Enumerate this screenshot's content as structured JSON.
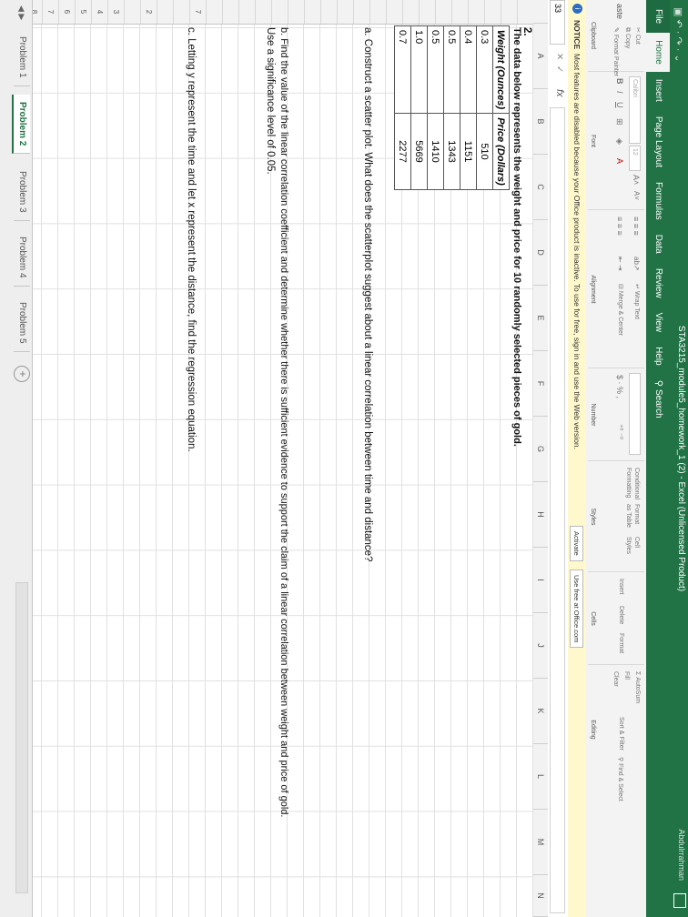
{
  "window": {
    "title": "STA3215_module5_homework_1 (2) - Excel (Unlicensed Product)",
    "user": "Abdulrrahman",
    "qat": "▣ ↶ · ↷ · ⌄"
  },
  "tabs": [
    "File",
    "Home",
    "Insert",
    "Page Layout",
    "Formulas",
    "Data",
    "Review",
    "View",
    "Help",
    "Search"
  ],
  "ribbon": {
    "clipboard": {
      "cut": "Cut",
      "copy": "Copy",
      "format_painter": "Format Painter",
      "paste": "aste",
      "label": "Clipboard"
    },
    "font": {
      "name": "Calibri",
      "size": "12",
      "bold": "B",
      "italic": "I",
      "underline": "U",
      "label": "Font"
    },
    "alignment": {
      "wrap": "Wrap Text",
      "merge": "Merge & Center",
      "label": "Alignment"
    },
    "number": {
      "currency": "$ · % ,",
      "label": "Number"
    },
    "styles": {
      "conditional": "Conditional Formatting",
      "format_as_table": "Format as Table",
      "cell_styles": "Cell Styles",
      "label": "Styles"
    },
    "cells": {
      "insert": "Insert",
      "delete": "Delete",
      "format": "Format",
      "label": "Cells"
    },
    "editing": {
      "autosum": "AutoSum",
      "fill": "Fill",
      "clear": "Clear",
      "sort": "Sort & Filter",
      "find": "Find & Select",
      "label": "Editing"
    }
  },
  "notice": {
    "label": "NOTICE",
    "text": "Most features are disabled because your Office product is inactive. To use for free, sign in and use the Web version.",
    "activate": "Activate",
    "use_free": "Use free at Office.com"
  },
  "formula_bar": {
    "name_box": "33",
    "fx": "fx"
  },
  "columns": [
    "A",
    "B",
    "C",
    "D",
    "E",
    "F",
    "G",
    "H",
    "I",
    "J",
    "K",
    "L",
    "M",
    "N"
  ],
  "rows": [
    "",
    "",
    "",
    "",
    "",
    "",
    "",
    "",
    "",
    "",
    "",
    "",
    "",
    "",
    "",
    "",
    "",
    "",
    "",
    "",
    "7",
    "",
    "",
    "2",
    "",
    "3",
    "4",
    "5",
    "6",
    "7",
    "8"
  ],
  "sheet": {
    "problem_number": "2.",
    "intro": "The data below represents the weight and price for 10 randomly selected pieces of gold.",
    "table_headers": [
      "Weight (Ounces)",
      "Price (Dollars)"
    ],
    "table_rows": [
      [
        "0.3",
        "510"
      ],
      [
        "0.4",
        "1151"
      ],
      [
        "0.5",
        "1343"
      ],
      [
        "0.5",
        "1410"
      ],
      [
        "1.0",
        "5669"
      ],
      [
        "0.7",
        "2277"
      ]
    ],
    "part_a": "a. Construct a scatter plot. What does the scatterplot suggest about a linear correlation between time and distance?",
    "part_b1": "b. Find the value of the linear correlation coefficient and determine whether there is sufficient evidence to support the claim of a linear correlation between weight and price of gold.",
    "part_b2": "Use a significance level of 0.05.",
    "part_c": "c. Letting y represent the time and let x represent the distance, find the regression equation."
  },
  "sheet_tabs": [
    "Problem 1",
    "Problem 2",
    "Problem 3",
    "Problem 4",
    "Problem 5"
  ],
  "active_sheet": "Problem 2"
}
